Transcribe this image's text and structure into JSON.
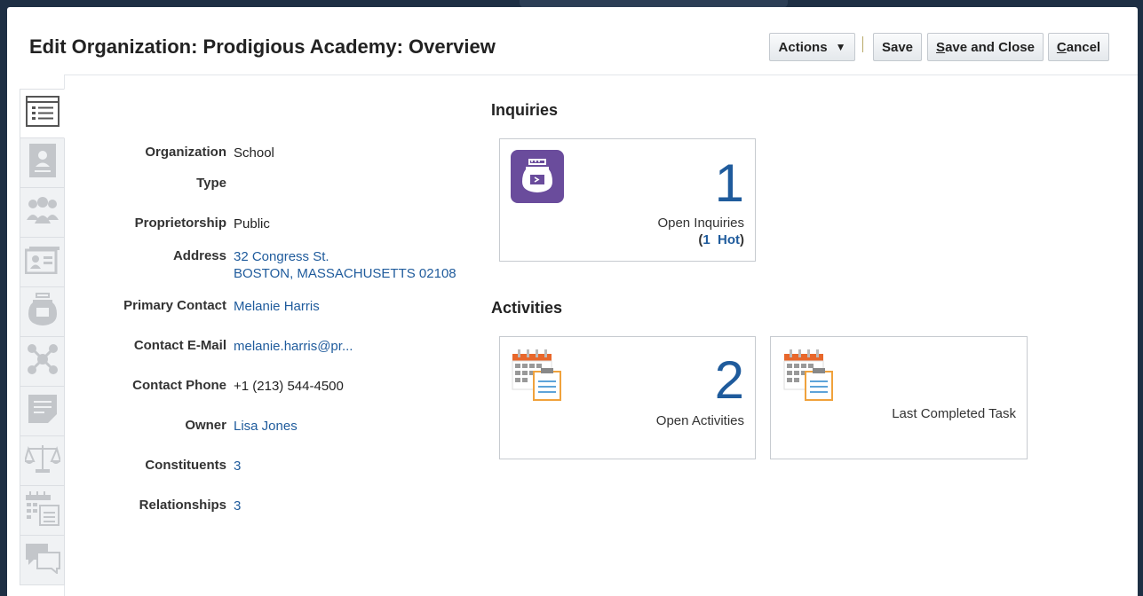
{
  "page": {
    "title": "Edit Organization: Prodigious Academy: Overview"
  },
  "toolbar": {
    "actions_label": "Actions",
    "save_label": "Save",
    "save_close_first": "S",
    "save_close_rest": "ave and Close",
    "cancel_first": "C",
    "cancel_rest": "ancel"
  },
  "sidebar": {
    "tabs": [
      {
        "icon": "overview-list-icon",
        "active": true
      },
      {
        "icon": "profile-card-icon"
      },
      {
        "icon": "people-group-icon"
      },
      {
        "icon": "contact-card-icon"
      },
      {
        "icon": "inquiry-jar-icon"
      },
      {
        "icon": "network-nodes-icon"
      },
      {
        "icon": "note-icon"
      },
      {
        "icon": "scales-icon"
      },
      {
        "icon": "calendar-task-icon"
      },
      {
        "icon": "chat-bubbles-icon"
      }
    ]
  },
  "fields": {
    "org_type_label_1": "Organization",
    "org_type_label_2": "Type",
    "org_type_value": "School",
    "proprietorship_label": "Proprietorship",
    "proprietorship_value": "Public",
    "address_label": "Address",
    "address_line1": "32 Congress St.",
    "address_line2": "BOSTON, MASSACHUSETTS 02108",
    "primary_contact_label": "Primary Contact",
    "primary_contact_value": "Melanie Harris",
    "email_label": "Contact E-Mail",
    "email_value": "melanie.harris@pr...",
    "phone_label": "Contact Phone",
    "phone_value": "+1 (213) 544-4500",
    "owner_label": "Owner",
    "owner_value": "Lisa Jones",
    "constituents_label": "Constituents",
    "constituents_value": "3",
    "relationships_label": "Relationships",
    "relationships_value": "3"
  },
  "inquiries": {
    "heading": "Inquiries",
    "count": "1",
    "label": "Open Inquiries",
    "hot_open": "(",
    "hot_count": "1",
    "hot_label": "Hot",
    "hot_close": ")",
    "icon_color": "#6a4c9c"
  },
  "activities": {
    "heading": "Activities",
    "open_count": "2",
    "open_label": "Open Activities",
    "last_completed_label": "Last Completed Task"
  },
  "colors": {
    "link": "#1f5b9c",
    "accent_orange": "#e8672b",
    "accent_purple": "#6a4c9c"
  }
}
